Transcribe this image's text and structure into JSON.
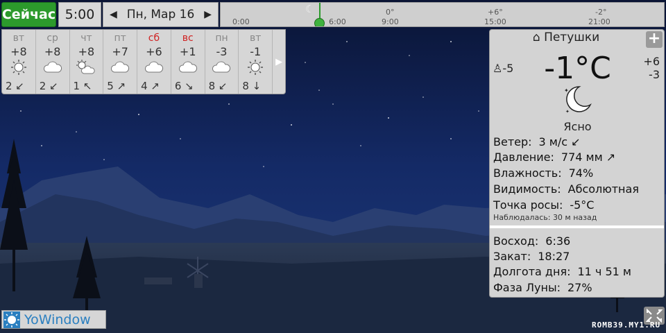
{
  "header": {
    "now_label": "Сейчас",
    "time": "5:00",
    "date": "Пн, Мар 16",
    "prev_icon": "triangle-left-icon",
    "next_icon": "triangle-right-icon"
  },
  "timeline": {
    "hours": [
      {
        "label": "0:00"
      },
      {
        "label": "6:00"
      },
      {
        "label": "9:00"
      },
      {
        "label": "15:00"
      },
      {
        "label": "21:00"
      }
    ],
    "temps": [
      {
        "label": "0°"
      },
      {
        "label": "+6°"
      },
      {
        "label": "-2°"
      }
    ],
    "marker_icon": "crescent-moon-icon"
  },
  "forecast": {
    "days": [
      {
        "name": "вт",
        "temp": "+8",
        "icon": "sun-icon",
        "wind": "2 ↙",
        "weekend": false
      },
      {
        "name": "ср",
        "temp": "+8",
        "icon": "cloud-icon",
        "wind": "2 ↙",
        "weekend": false
      },
      {
        "name": "чт",
        "temp": "+8",
        "icon": "sun-cloud-icon",
        "wind": "1 ↖",
        "weekend": false
      },
      {
        "name": "пт",
        "temp": "+7",
        "icon": "cloud-icon",
        "wind": "5 ↗",
        "weekend": false
      },
      {
        "name": "сб",
        "temp": "+6",
        "icon": "cloud-icon",
        "wind": "4 ↗",
        "weekend": true
      },
      {
        "name": "вс",
        "temp": "+1",
        "icon": "cloud-icon",
        "wind": "6 ↘",
        "weekend": true
      },
      {
        "name": "пн",
        "temp": "-3",
        "icon": "cloud-icon",
        "wind": "8 ↙",
        "weekend": false
      },
      {
        "name": "вт",
        "temp": "-1",
        "icon": "sun-icon",
        "wind": "8 ↓",
        "weekend": false
      }
    ],
    "next_icon": "triangle-right-icon"
  },
  "current": {
    "location": "Петушки",
    "home_icon": "home-icon",
    "add_icon": "plus-icon",
    "feels_like": "-5",
    "person_icon": "person-icon",
    "temperature": "-1°C",
    "high": "+6",
    "low": "-3",
    "condition": "Ясно",
    "condition_icon": "crescent-moon-icon",
    "wind_label": "Ветер:",
    "wind_value": "3 м/с ↙",
    "pressure_label": "Давление:",
    "pressure_value": "774 мм ↗",
    "humidity_label": "Влажность:",
    "humidity_value": "74%",
    "visibility_label": "Видимость:",
    "visibility_value": "Абсолютная",
    "dewpoint_label": "Точка росы:",
    "dewpoint_value": "-5°C",
    "observed": "Наблюдалась:  30 м назад",
    "sunrise_label": "Восход:",
    "sunrise_value": "6:36",
    "sunset_label": "Закат:",
    "sunset_value": "18:27",
    "daylength_label": "Долгота дня:",
    "daylength_value": "11 ч 51 м",
    "moonphase_label": "Фаза Луны:",
    "moonphase_value": "27%"
  },
  "footer": {
    "brand": "YoWindow",
    "brand_icon": "sun-logo-icon",
    "expand_icon": "expand-icon",
    "watermark": "ROMB39.MY1.RU"
  },
  "colors": {
    "now_button": "#2c9a2c",
    "weekend": "#d02020",
    "brand": "#2a7fc0",
    "sky_top": "#0c1636"
  }
}
